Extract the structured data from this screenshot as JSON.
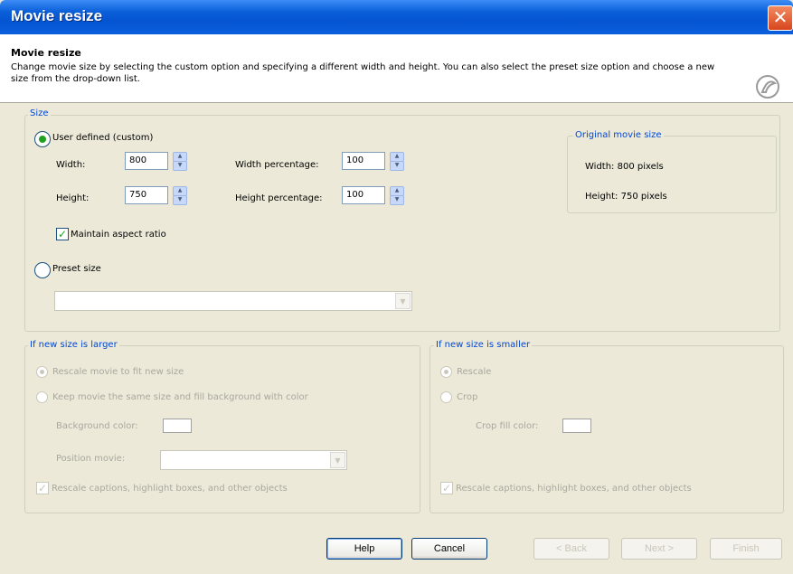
{
  "window": {
    "title": "Movie resize",
    "close_label": "✕"
  },
  "header": {
    "title": "Movie resize",
    "description": "Change movie size by selecting the custom option and specifying a different width and height. You can also select the preset size option and choose a new size from the drop-down list."
  },
  "size": {
    "legend": "Size",
    "custom_label": "User defined (custom)",
    "width_label": "Width:",
    "width_value": "800",
    "height_label": "Height:",
    "height_value": "750",
    "width_pct_label": "Width percentage:",
    "width_pct_value": "100",
    "height_pct_label": "Height percentage:",
    "height_pct_value": "100",
    "maintain_label": "Maintain aspect ratio",
    "preset_label": "Preset size",
    "preset_value": ""
  },
  "original": {
    "legend": "Original movie size",
    "width_text": "Width: 800 pixels",
    "height_text": "Height: 750 pixels"
  },
  "larger": {
    "legend": "If new size is larger",
    "rescale_label": "Rescale movie to fit new size",
    "keep_label": "Keep movie the same size and fill background with color",
    "bg_color_label": "Background color:",
    "position_label": "Position movie:",
    "position_value": "",
    "rescale_objects_label": "Rescale captions, highlight boxes, and other objects"
  },
  "smaller": {
    "legend": "If new size is smaller",
    "rescale_label": "Rescale",
    "crop_label": "Crop",
    "crop_fill_label": "Crop fill color:",
    "rescale_objects_label": "Rescale captions, highlight boxes, and other objects"
  },
  "buttons": {
    "help": "Help",
    "cancel": "Cancel",
    "back": "< Back",
    "next": "Next >",
    "finish": "Finish"
  },
  "colors": {
    "title_bar": "#0554d1",
    "dialog_bg": "#ece9d8",
    "legend_text": "#0046d5",
    "check_green": "#21a121"
  }
}
